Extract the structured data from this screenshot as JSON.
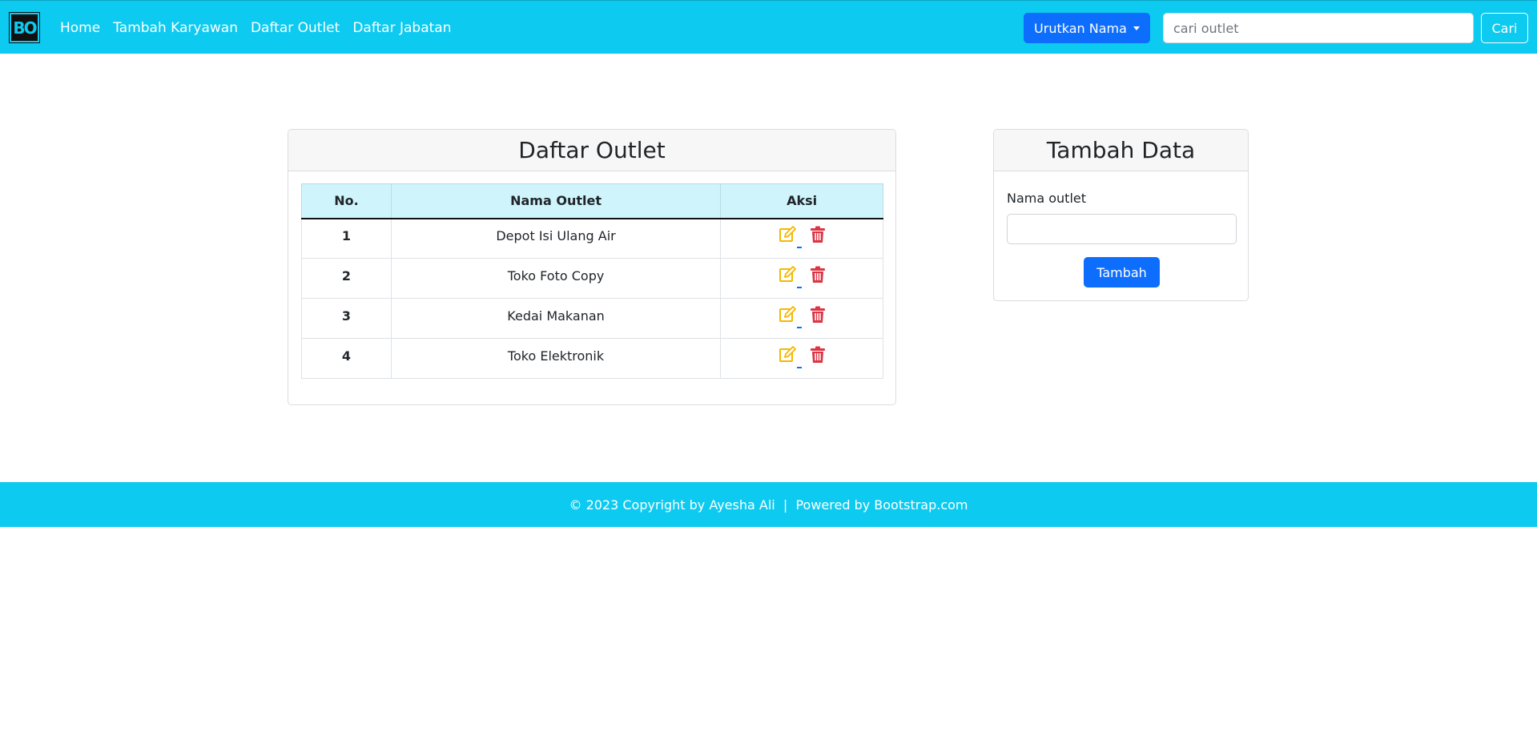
{
  "navbar": {
    "brand_text": "BO",
    "links": [
      "Home",
      "Tambah Karyawan",
      "Daftar Outlet",
      "Daftar Jabatan"
    ],
    "sort_button": "Urutkan Nama",
    "search_placeholder": "cari outlet",
    "search_button": "Cari"
  },
  "outlet_card": {
    "title": "Daftar Outlet",
    "columns": [
      "No.",
      "Nama Outlet",
      "Aksi"
    ],
    "rows": [
      {
        "no": "1",
        "name": "Depot Isi Ulang Air"
      },
      {
        "no": "2",
        "name": "Toko Foto Copy"
      },
      {
        "no": "3",
        "name": "Kedai Makanan"
      },
      {
        "no": "4",
        "name": "Toko Elektronik"
      }
    ],
    "action_icons": [
      "edit-icon",
      "trash-icon"
    ]
  },
  "add_card": {
    "title": "Tambah Data",
    "field_label": "Nama outlet",
    "field_value": "",
    "submit_label": "Tambah"
  },
  "footer": {
    "text": "© 2023 Copyright by Ayesha Ali  |  Powered by Bootstrap.com"
  },
  "colors": {
    "navbar": "#0dcaf0",
    "primary": "#0d6efd",
    "table_header": "#cff4fc",
    "edit_icon": "#f5b800",
    "delete_icon": "#dc3545"
  }
}
